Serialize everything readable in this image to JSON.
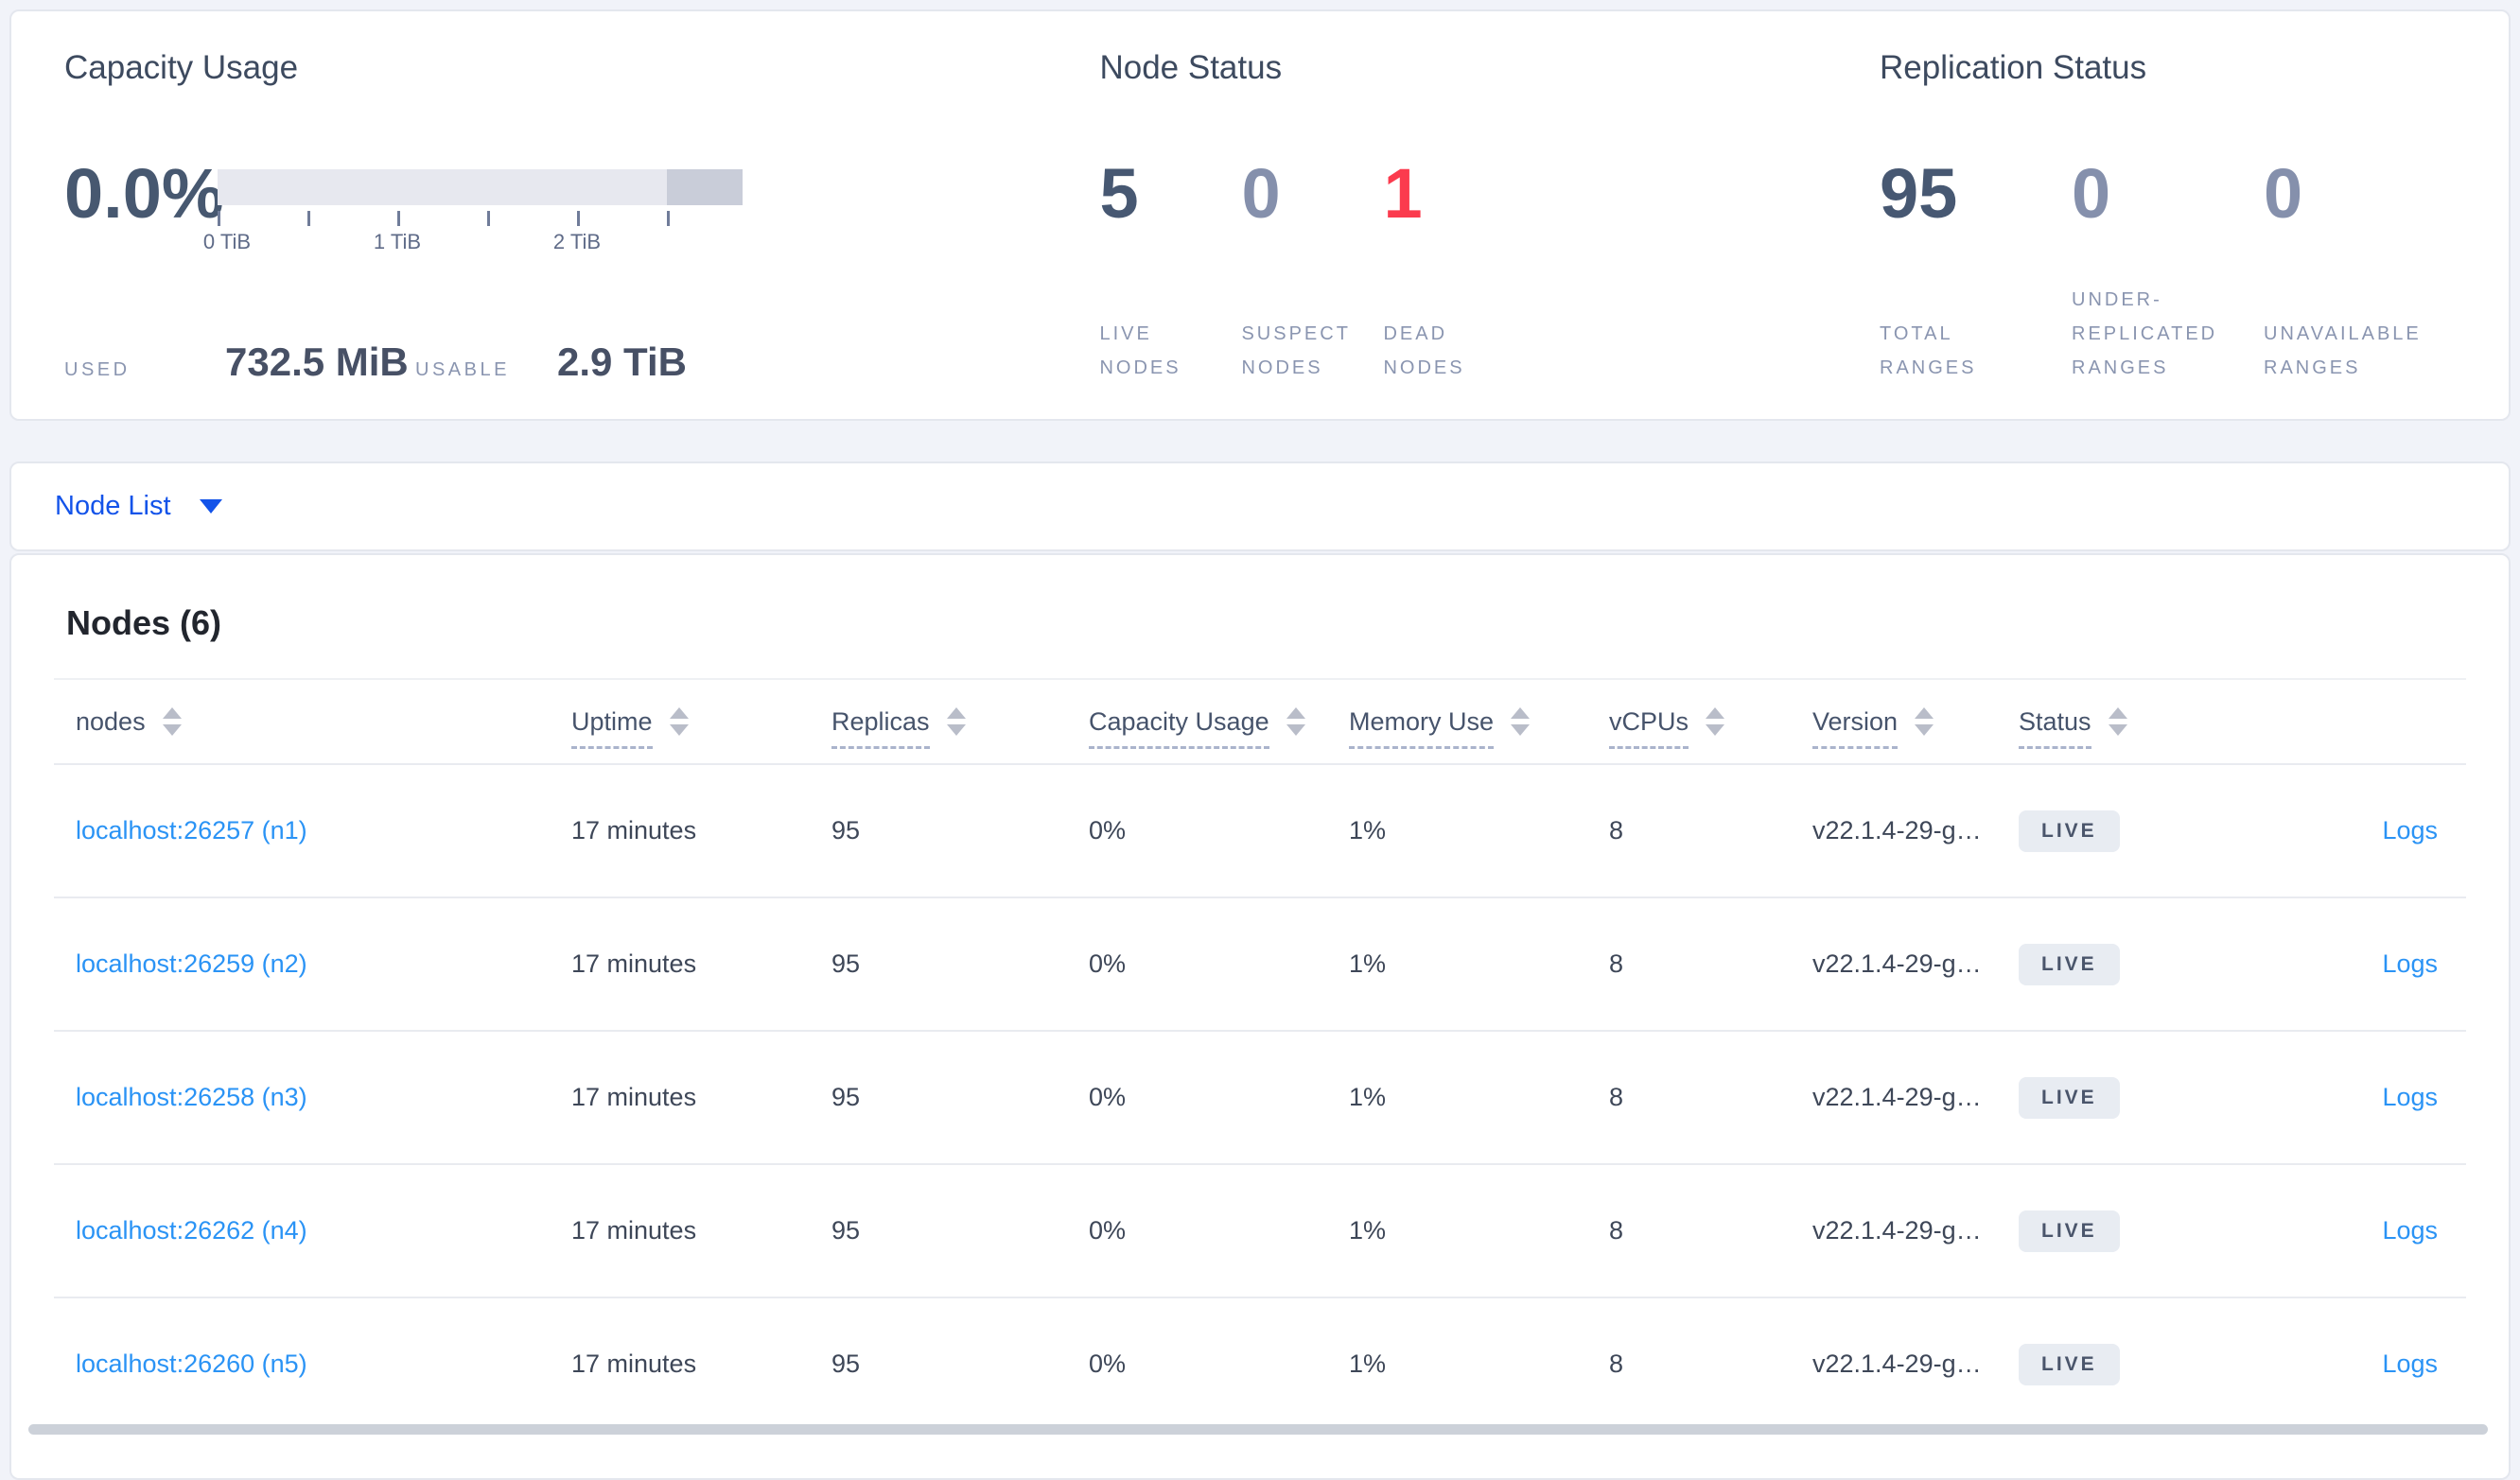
{
  "summary": {
    "capacity": {
      "title": "Capacity Usage",
      "percent": "0.0%",
      "tick_labels": [
        "0 TiB",
        "1 TiB",
        "2 TiB"
      ],
      "used_label": "USED",
      "used_value": "732.5 MiB",
      "usable_label": "USABLE",
      "usable_value": "2.9 TiB"
    },
    "node_status": {
      "title": "Node Status",
      "stats": [
        {
          "value": "5",
          "label": "LIVE NODES",
          "tone": "dark"
        },
        {
          "value": "0",
          "label": "SUSPECT NODES",
          "tone": "muted"
        },
        {
          "value": "1",
          "label": "DEAD NODES",
          "tone": "danger"
        }
      ]
    },
    "replication": {
      "title": "Replication Status",
      "stats": [
        {
          "value": "95",
          "label": "TOTAL RANGES",
          "tone": "dark"
        },
        {
          "value": "0",
          "label": "UNDER-REPLICATED RANGES",
          "tone": "muted"
        },
        {
          "value": "0",
          "label": "UNAVAILABLE RANGES",
          "tone": "muted"
        }
      ]
    }
  },
  "view_selector": {
    "label": "Node List"
  },
  "table": {
    "title": "Nodes (6)",
    "columns": [
      {
        "label": "nodes"
      },
      {
        "label": "Uptime"
      },
      {
        "label": "Replicas"
      },
      {
        "label": "Capacity Usage"
      },
      {
        "label": "Memory Use"
      },
      {
        "label": "vCPUs"
      },
      {
        "label": "Version"
      },
      {
        "label": "Status"
      }
    ],
    "rows": [
      {
        "node": "localhost:26257 (n1)",
        "uptime": "17 minutes",
        "replicas": "95",
        "capacity": "0%",
        "memory": "1%",
        "vcpus": "8",
        "version": "v22.1.4-29-g…",
        "status": "LIVE",
        "logs": "Logs"
      },
      {
        "node": "localhost:26259 (n2)",
        "uptime": "17 minutes",
        "replicas": "95",
        "capacity": "0%",
        "memory": "1%",
        "vcpus": "8",
        "version": "v22.1.4-29-g…",
        "status": "LIVE",
        "logs": "Logs"
      },
      {
        "node": "localhost:26258 (n3)",
        "uptime": "17 minutes",
        "replicas": "95",
        "capacity": "0%",
        "memory": "1%",
        "vcpus": "8",
        "version": "v22.1.4-29-g…",
        "status": "LIVE",
        "logs": "Logs"
      },
      {
        "node": "localhost:26262 (n4)",
        "uptime": "17 minutes",
        "replicas": "95",
        "capacity": "0%",
        "memory": "1%",
        "vcpus": "8",
        "version": "v22.1.4-29-g…",
        "status": "LIVE",
        "logs": "Logs"
      },
      {
        "node": "localhost:26260 (n5)",
        "uptime": "17 minutes",
        "replicas": "95",
        "capacity": "0%",
        "memory": "1%",
        "vcpus": "8",
        "version": "v22.1.4-29-g…",
        "status": "LIVE",
        "logs": "Logs"
      }
    ]
  },
  "colors": {
    "accent_blue": "#1353e9",
    "link_blue": "#2a93f5",
    "danger_red": "#fb3b4e",
    "stat_dark": "#475872",
    "stat_muted": "#8590ac",
    "badge_bg": "#e8ecf2"
  }
}
